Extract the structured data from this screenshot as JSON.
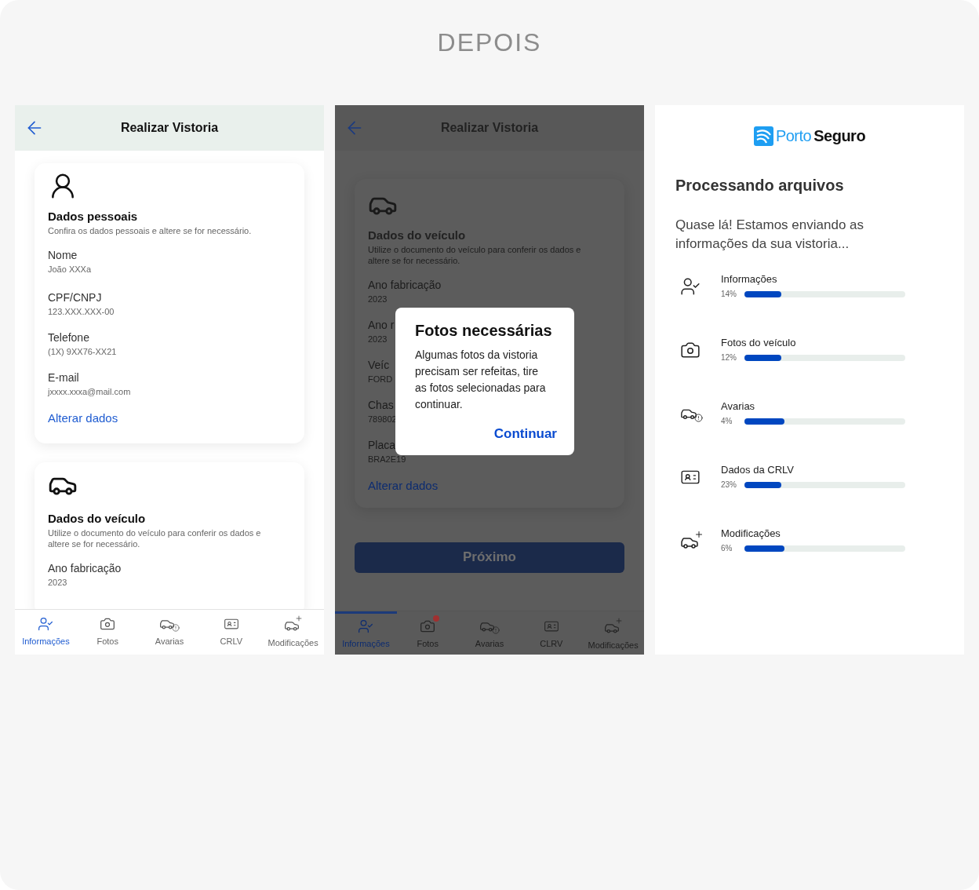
{
  "heading": "DEPOIS",
  "screen_form": {
    "title": "Realizar Vistoria",
    "cards": [
      {
        "title": "Dados pessoais",
        "description": "Confira os dados pessoais e altere se for necessário.",
        "fields": [
          {
            "label": "Nome",
            "value": "João XXXa"
          },
          {
            "label": "CPF/CNPJ",
            "value": "123.XXX.XXX-00"
          },
          {
            "label": "Telefone",
            "value": "(1X) 9XX76-XX21"
          },
          {
            "label": "E-mail",
            "value": "jxxxx.xxxa@mail.com"
          }
        ],
        "link": "Alterar dados"
      },
      {
        "title": "Dados do veículo",
        "description": "Utilize o documento do veículo para conferir os dados e altere se for necessário.",
        "fields": [
          {
            "label": "Ano fabricação",
            "value": "2023"
          }
        ]
      }
    ],
    "nav": [
      {
        "label": "Informações",
        "selected": true
      },
      {
        "label": "Fotos",
        "selected": false
      },
      {
        "label": "Avarias",
        "selected": false
      },
      {
        "label": "CRLV",
        "selected": false
      },
      {
        "label": "Modificações",
        "selected": false
      }
    ]
  },
  "screen_dialog": {
    "title": "Realizar Vistoria",
    "card": {
      "title": "Dados do veículo",
      "description": "Utilize o documento do veículo para conferir os dados e altere se for necessário.",
      "fields": [
        {
          "label": "Ano fabricação",
          "value": "2023"
        },
        {
          "label": "Ano r",
          "value": "2023"
        },
        {
          "label": "Veíc",
          "value": "FORD"
        },
        {
          "label": "Chas",
          "value": "789802"
        },
        {
          "label": "Placa",
          "value": "BRA2E19"
        }
      ],
      "link": "Alterar dados"
    },
    "button": "Próximo",
    "dialog": {
      "title": "Fotos necessárias",
      "message": "Algumas fotos da vistoria precisam ser refeitas, tire as fotos selecionadas para continuar.",
      "action": "Continuar"
    },
    "nav": [
      {
        "label": "Informações",
        "selected": true,
        "alert": false
      },
      {
        "label": "Fotos",
        "selected": false,
        "alert": true
      },
      {
        "label": "Avarias",
        "selected": false,
        "alert": false
      },
      {
        "label": "CLRV",
        "selected": false,
        "alert": false
      },
      {
        "label": "Modificações",
        "selected": false,
        "alert": false
      }
    ]
  },
  "screen_progress": {
    "logo": {
      "first": "Porto",
      "second": "Seguro"
    },
    "title": "Processando arquivos",
    "message": "Quase lá! Estamos enviando as informações da sua vistoria...",
    "items": [
      {
        "label": "Informações",
        "percent": "14%",
        "level": 0.23
      },
      {
        "label": "Fotos do veículo",
        "percent": "12%",
        "level": 0.23
      },
      {
        "label": "Avarias",
        "percent": "4%",
        "level": 0.25
      },
      {
        "label": "Dados da CRLV",
        "percent": "23%",
        "level": 0.23
      },
      {
        "label": "Modificações",
        "percent": "6%",
        "level": 0.25
      }
    ]
  }
}
